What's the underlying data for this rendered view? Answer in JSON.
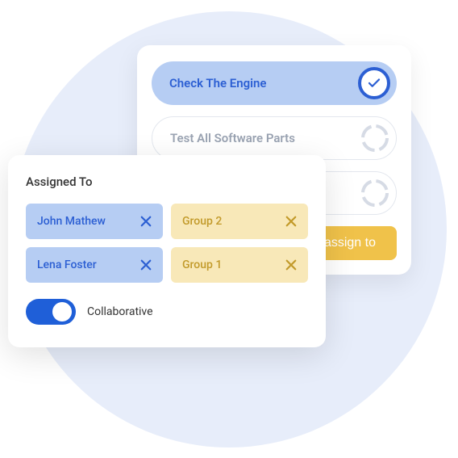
{
  "tasks": {
    "items": [
      {
        "label": "Check The Engine",
        "status": "done"
      },
      {
        "label": "Test All Software Parts",
        "status": "pending"
      },
      {
        "label": "",
        "status": "pending"
      }
    ],
    "assignButton": "assign to"
  },
  "assigned": {
    "title": "Assigned To",
    "people": [
      {
        "name": "John Mathew"
      },
      {
        "name": "Lena Foster"
      }
    ],
    "groups": [
      {
        "name": "Group 2"
      },
      {
        "name": "Group 1"
      }
    ],
    "collaborative": {
      "label": "Collaborative",
      "value": true
    }
  },
  "colors": {
    "accentBlue": "#2c5fd3",
    "chipBlue": "#b6cdf3",
    "chipYellow": "#f8e8b8",
    "buttonYellow": "#f0c24a",
    "bgCircle": "#e7edfa"
  }
}
